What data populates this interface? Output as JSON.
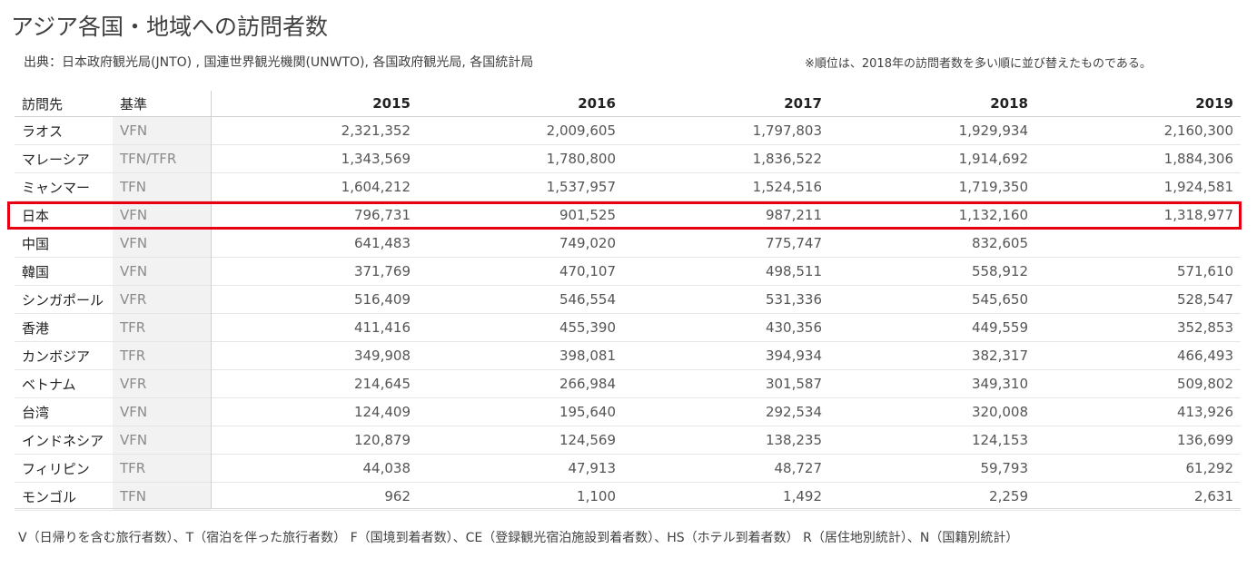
{
  "title": "アジア各国・地域への訪問者数",
  "source": "出典：日本政府観光局(JNTO) , 国連世界観光機関(UNWTO), 各国政府観光局, 各国統計局",
  "note": "※順位は、2018年の訪問者数を多い順に並び替えたものである。",
  "table": {
    "headers": {
      "destination": "訪問先",
      "basis": "基準",
      "years": [
        "2015",
        "2016",
        "2017",
        "2018",
        "2019"
      ]
    },
    "rows": [
      {
        "name": "ラオス",
        "basis": "VFN",
        "values": [
          "2,321,352",
          "2,009,605",
          "1,797,803",
          "1,929,934",
          "2,160,300"
        ]
      },
      {
        "name": "マレーシア",
        "basis": "TFN/TFR",
        "values": [
          "1,343,569",
          "1,780,800",
          "1,836,522",
          "1,914,692",
          "1,884,306"
        ]
      },
      {
        "name": "ミャンマー",
        "basis": "TFN",
        "values": [
          "1,604,212",
          "1,537,957",
          "1,524,516",
          "1,719,350",
          "1,924,581"
        ]
      },
      {
        "name": "日本",
        "basis": "VFN",
        "values": [
          "796,731",
          "901,525",
          "987,211",
          "1,132,160",
          "1,318,977"
        ]
      },
      {
        "name": "中国",
        "basis": "VFN",
        "values": [
          "641,483",
          "749,020",
          "775,747",
          "832,605",
          ""
        ]
      },
      {
        "name": "韓国",
        "basis": "VFN",
        "values": [
          "371,769",
          "470,107",
          "498,511",
          "558,912",
          "571,610"
        ]
      },
      {
        "name": "シンガポール",
        "basis": "VFR",
        "values": [
          "516,409",
          "546,554",
          "531,336",
          "545,650",
          "528,547"
        ]
      },
      {
        "name": "香港",
        "basis": "TFR",
        "values": [
          "411,416",
          "455,390",
          "430,356",
          "449,559",
          "352,853"
        ]
      },
      {
        "name": "カンボジア",
        "basis": "TFR",
        "values": [
          "349,908",
          "398,081",
          "394,934",
          "382,317",
          "466,493"
        ]
      },
      {
        "name": "ベトナム",
        "basis": "VFR",
        "values": [
          "214,645",
          "266,984",
          "301,587",
          "349,310",
          "509,802"
        ]
      },
      {
        "name": "台湾",
        "basis": "VFN",
        "values": [
          "124,409",
          "195,640",
          "292,534",
          "320,008",
          "413,926"
        ]
      },
      {
        "name": "インドネシア",
        "basis": "VFN",
        "values": [
          "120,879",
          "124,569",
          "138,235",
          "124,153",
          "136,699"
        ]
      },
      {
        "name": "フィリピン",
        "basis": "TFR",
        "values": [
          "44,038",
          "47,913",
          "48,727",
          "59,793",
          "61,292"
        ]
      },
      {
        "name": "モンゴル",
        "basis": "TFN",
        "values": [
          "962",
          "1,100",
          "1,492",
          "2,259",
          "2,631"
        ]
      }
    ],
    "highlighted_row": "日本",
    "highlight_color": "#e60012"
  },
  "footer": "V（日帰りを含む旅行者数）、T（宿泊を伴った旅行者数） F（国境到着者数）、CE（登録観光宿泊施設到着者数）、HS（ホテル到着者数） R（居住地別統計）、N（国籍別統計）"
}
